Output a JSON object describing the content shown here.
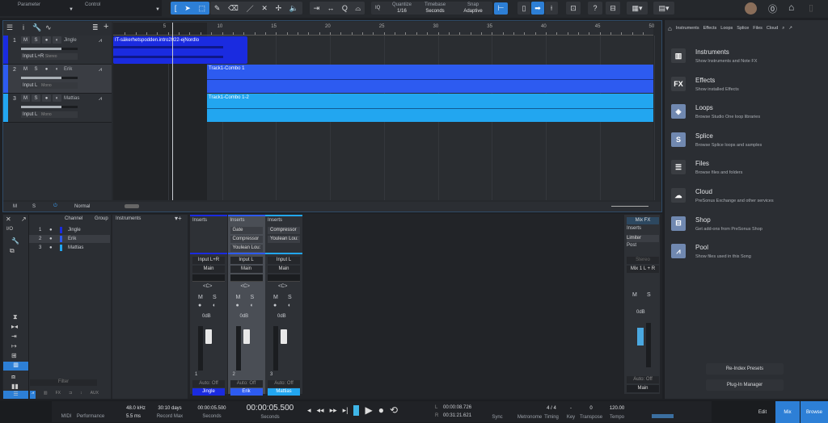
{
  "toolbar": {
    "parameter": "Parameter",
    "control": "Control",
    "quantize_label": "Quantize",
    "quantize": "1/16",
    "timebase_label": "Timebase",
    "timebase": "Seconds",
    "snap_label": "Snap",
    "snap": "Adaptive",
    "iq": "IQ",
    "help": "?"
  },
  "ruler": {
    "ticks": [
      "5",
      "10",
      "15",
      "20",
      "25",
      "30",
      "35",
      "40",
      "45",
      "50"
    ]
  },
  "tracks": [
    {
      "num": "1",
      "name": "Jingle",
      "input": "Input L+R",
      "mode": "Stereo",
      "color": "#1a2be0"
    },
    {
      "num": "2",
      "name": "Erik",
      "input": "Input L",
      "mode": "Mono",
      "color": "#2d5bf0"
    },
    {
      "num": "3",
      "name": "Mattias",
      "input": "Input L",
      "mode": "Mono",
      "color": "#22a6f0"
    }
  ],
  "clips": [
    {
      "name": "IT-säkerhetspodden.intro2022-ejNordlo",
      "color": "#1a2be0"
    },
    {
      "name": "Track1-Combo 1",
      "color": "#2d5bf0"
    },
    {
      "name": "Track1-Combo 1-2",
      "color": "#22a6f0"
    }
  ],
  "arrange_footer": {
    "m": "M",
    "s": "S",
    "mode": "Normal"
  },
  "browser": {
    "tabs": [
      "Instruments",
      "Effects",
      "Loops",
      "Splice",
      "Files",
      "Cloud"
    ],
    "items": [
      {
        "title": "Instruments",
        "desc": "Show Instruments and Note FX",
        "icon": "piano-icon"
      },
      {
        "title": "Effects",
        "desc": "Show installed Effects",
        "icon": "fx-icon"
      },
      {
        "title": "Loops",
        "desc": "Browse Studio One loop libraries",
        "icon": "loops-icon"
      },
      {
        "title": "Splice",
        "desc": "Browse Splice loops and samples",
        "icon": "splice-icon"
      },
      {
        "title": "Files",
        "desc": "Browse files and folders",
        "icon": "files-icon"
      },
      {
        "title": "Cloud",
        "desc": "PreSonus Exchange and other services",
        "icon": "cloud-icon"
      },
      {
        "title": "Shop",
        "desc": "Get add-ons from PreSonus Shop",
        "icon": "shop-icon"
      },
      {
        "title": "Pool",
        "desc": "Show files used in this Song",
        "icon": "pool-icon"
      }
    ],
    "reindex": "Re-Index Presets",
    "plugin_manager": "Plug-In Manager"
  },
  "mixer": {
    "channel_header": "Channel",
    "group_header": "Group",
    "instruments": "Instruments",
    "io": "I/O",
    "filter_placeholder": "Filter",
    "bottom_tabs": [
      "FX",
      "AUX"
    ],
    "channels": [
      {
        "num": "1",
        "name": "Jingle",
        "input": "Input L+R",
        "output": "Main",
        "inserts": [],
        "vol": "0dB",
        "auto": "Auto: Off",
        "color": "#1a2be0"
      },
      {
        "num": "2",
        "name": "Erik",
        "input": "Input L",
        "output": "Main",
        "inserts": [
          "Gate",
          "Compressor",
          "Youlean Lou:"
        ],
        "vol": "0dB",
        "auto": "Auto: Off",
        "color": "#2d5bf0"
      },
      {
        "num": "3",
        "name": "Mattias",
        "input": "Input L",
        "output": "Main",
        "inserts": [
          "Compressor",
          "Youlean Lou:"
        ],
        "vol": "0dB",
        "auto": "Auto: Off",
        "color": "#22a6f0"
      }
    ],
    "inserts_label": "Inserts",
    "pan": "<C>",
    "m": "M",
    "s": "S",
    "scale": [
      "10",
      "6",
      "0",
      "-6",
      "-12",
      "-18",
      "-24",
      "-30",
      "-36",
      "-48"
    ],
    "main": {
      "mixfx": "Mix FX",
      "inserts": "Inserts",
      "insert": "Limiter",
      "post": "Post",
      "stereo": "Stereo",
      "output": "Mix 1 L + R",
      "vol": "0dB",
      "auto": "Auto: Off",
      "name": "Main"
    }
  },
  "transport": {
    "midi": "MIDI",
    "performance": "Performance",
    "sample_rate": "48.0 kHz",
    "latency": "5.5 ms",
    "record_max": "30:10 days",
    "record_max_label": "Record Max",
    "time_small": "00:00:05.500",
    "time_small_unit": "Seconds",
    "time_big": "00:00:05.500",
    "time_big_unit": "Seconds",
    "loop_l": "00:00:08.726",
    "loop_r": "00:31:21.621",
    "l": "L",
    "r": "R",
    "sync": "Sync",
    "metronome": "Metronome",
    "timing": "Timing",
    "timing_val": "4 / 4",
    "key": "Key",
    "key_val": "-",
    "transpose": "Transpose",
    "transpose_val": "0",
    "tempo": "Tempo",
    "tempo_val": "120.00",
    "edit": "Edit",
    "mix": "Mix",
    "browse": "Browse"
  }
}
